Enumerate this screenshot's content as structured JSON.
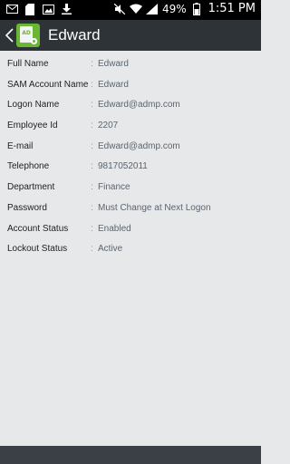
{
  "status_bar": {
    "battery_percent": "49%",
    "time": "1:51 PM",
    "left_icons": [
      "envelope-icon",
      "sd-card-icon",
      "gallery-icon",
      "download-icon"
    ],
    "right_icons": [
      "mute-icon",
      "wifi-icon",
      "signal-icon",
      "battery-icon"
    ]
  },
  "header": {
    "title": "Edward",
    "app_icon_text": "AD"
  },
  "details": [
    {
      "label": "Full Name",
      "separator": ":",
      "value": "Edward"
    },
    {
      "label": "SAM Account Name",
      "separator": ":",
      "value": "Edward"
    },
    {
      "label": "Logon Name",
      "separator": ":",
      "value": "Edward@admp.com"
    },
    {
      "label": "Employee Id",
      "separator": ":",
      "value": "2207"
    },
    {
      "label": "E-mail",
      "separator": ":",
      "value": "Edward@admp.com"
    },
    {
      "label": "Telephone",
      "separator": ":",
      "value": "9817052011"
    },
    {
      "label": "Department",
      "separator": ":",
      "value": "Finance"
    },
    {
      "label": "Password",
      "separator": ":",
      "value": "Must Change at Next Logon"
    },
    {
      "label": "Account Status",
      "separator": ":",
      "value": "Enabled"
    },
    {
      "label": "Lockout Status",
      "separator": ":",
      "value": "Active"
    }
  ],
  "colors": {
    "action_bar": "#2e3338",
    "background": "#e7e8ea",
    "app_icon": "#6ab733",
    "bottom_bar": "#3a4046"
  }
}
